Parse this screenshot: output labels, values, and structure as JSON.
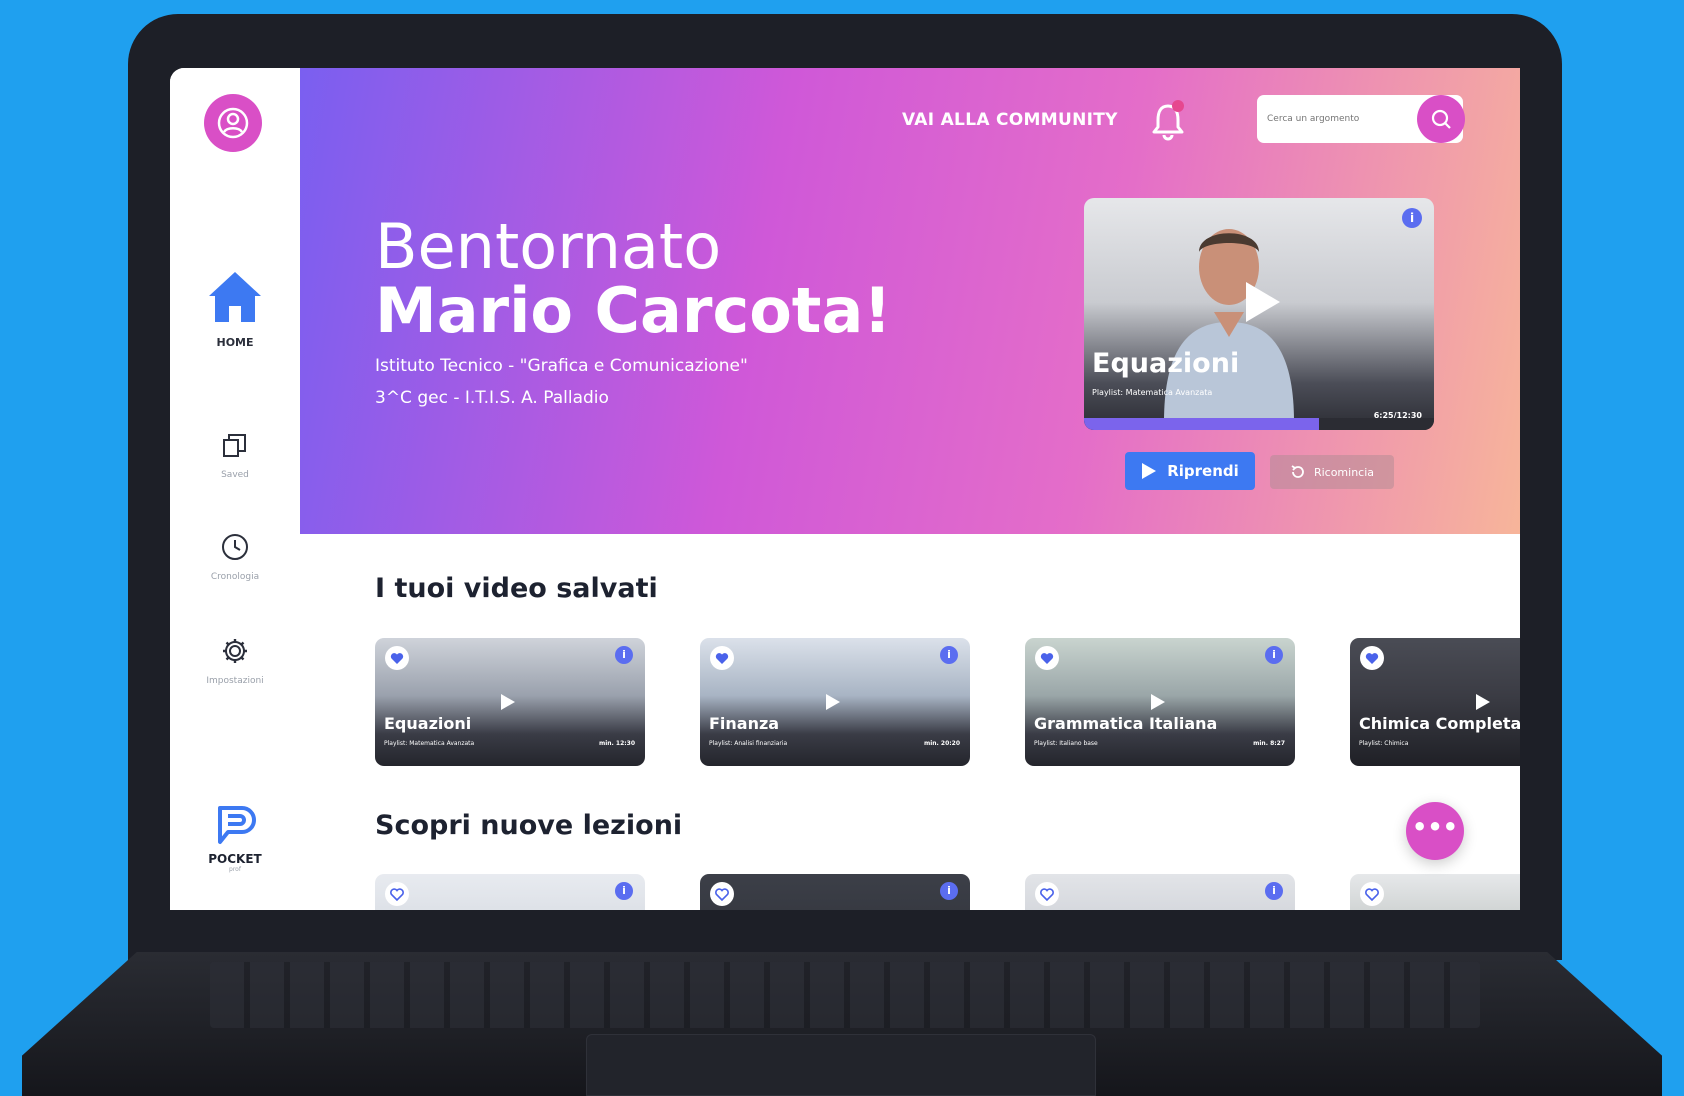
{
  "colors": {
    "background": "#1fa0ef",
    "accent": "#d94fc6",
    "primary_button": "#3d79f2",
    "info": "#5b6df0"
  },
  "sidebar": {
    "items": [
      {
        "label": "HOME",
        "icon": "home-icon",
        "active": true
      },
      {
        "label": "Saved",
        "icon": "library-icon"
      },
      {
        "label": "Cronologia",
        "icon": "clock-icon"
      },
      {
        "label": "Impostazioni",
        "icon": "gear-icon"
      }
    ],
    "brand": {
      "name": "POCKET",
      "sub": "prof"
    }
  },
  "topbar": {
    "community_link": "VAI ALLA COMMUNITY",
    "search_placeholder": "Cerca un argomento"
  },
  "hero": {
    "greeting": "Bentornato",
    "user_name": "Mario Carcota!",
    "school_line": "Istituto Tecnico - \"Grafica e Comunicazione\"",
    "class_line": "3^C gec - I.T.I.S. A. Palladio",
    "featured": {
      "title": "Equazioni",
      "playlist": "Playlist: Matematica Avanzata",
      "time": "6:25/12:30",
      "progress": 0.67,
      "resume_label": "Riprendi",
      "restart_label": "Ricomincia"
    }
  },
  "saved": {
    "title": "I tuoi video salvati",
    "cards": [
      {
        "title": "Equazioni",
        "playlist": "Playlist: Matematica Avanzata",
        "duration": "min. 12:30"
      },
      {
        "title": "Finanza",
        "playlist": "Playlist: Analisi finanziaria",
        "duration": "min. 20:20"
      },
      {
        "title": "Grammatica Italiana",
        "playlist": "Playlist: Italiano base",
        "duration": "min. 8:27"
      },
      {
        "title": "Chimica Completa",
        "playlist": "Playlist: Chimica",
        "duration": ""
      }
    ]
  },
  "discover": {
    "title": "Scopri nuove lezioni"
  },
  "chat": {
    "label": "•••"
  }
}
